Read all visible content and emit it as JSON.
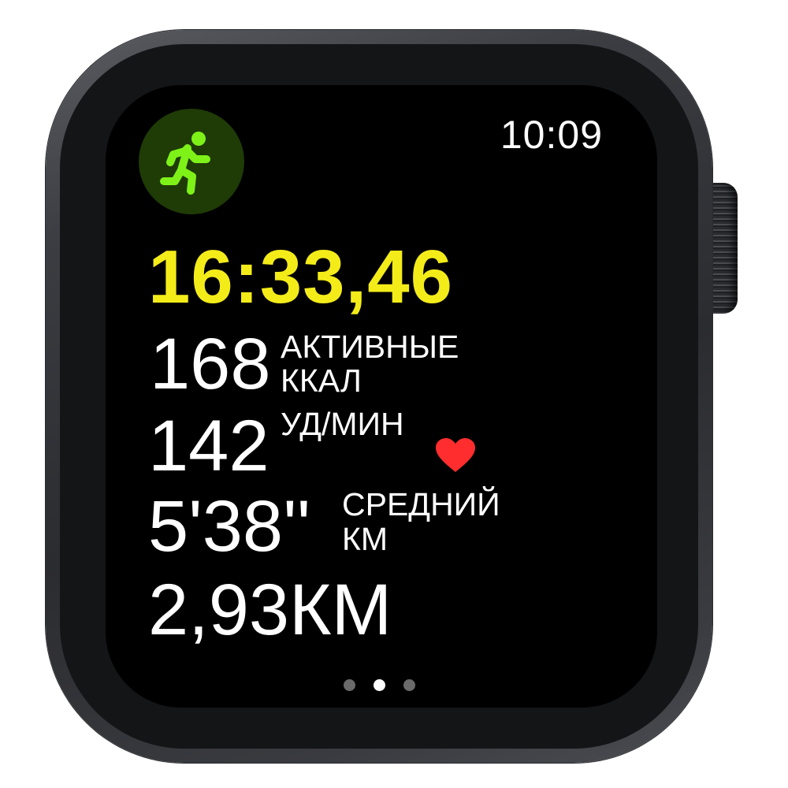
{
  "status": {
    "time": "10:09"
  },
  "workout": {
    "icon": "running-figure-icon",
    "elapsed_time": "16:33,46",
    "active_calories": {
      "value": "168",
      "unit_line1": "АКТИВНЫЕ",
      "unit_line2": "ККАЛ"
    },
    "heart_rate": {
      "value": "142",
      "unit": "УД/МИН",
      "icon": "heart-icon"
    },
    "pace": {
      "value": "5'38''",
      "unit_line1": "СРЕДНИЙ",
      "unit_line2": "КМ"
    },
    "distance": {
      "value": "2,93КМ"
    }
  },
  "pagination": {
    "total": 3,
    "active_index": 1
  },
  "colors": {
    "elapsed": "#f4ec19",
    "icon_green": "#7ef218",
    "icon_bg": "#1f3b06",
    "heart": "#ff2d2d"
  }
}
